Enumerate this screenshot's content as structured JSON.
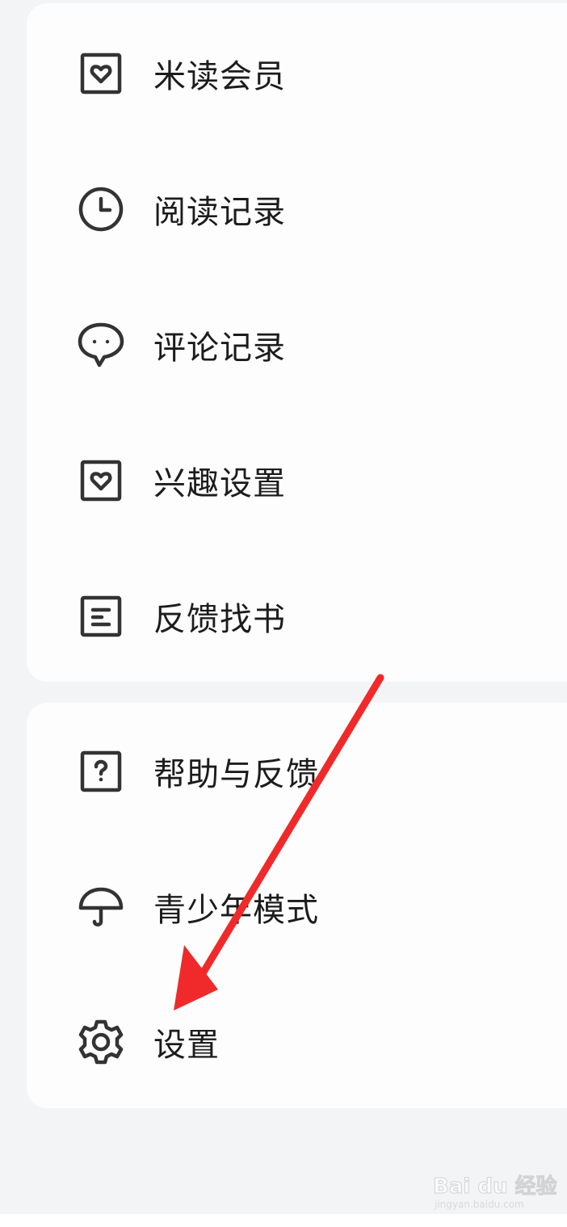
{
  "menu_group_1": [
    {
      "label": "米读会员",
      "icon": "heart-square-icon"
    },
    {
      "label": "阅读记录",
      "icon": "clock-icon"
    },
    {
      "label": "评论记录",
      "icon": "chat-bubble-icon"
    },
    {
      "label": "兴趣设置",
      "icon": "heart-square-icon"
    },
    {
      "label": "反馈找书",
      "icon": "document-icon"
    }
  ],
  "menu_group_2": [
    {
      "label": "帮助与反馈",
      "icon": "help-square-icon"
    },
    {
      "label": "青少年模式",
      "icon": "umbrella-icon"
    },
    {
      "label": "设置",
      "icon": "gear-icon"
    }
  ],
  "annotation": {
    "color": "#f02a2a",
    "target": "设置"
  },
  "watermark": {
    "main": "Bai du 经验",
    "sub": "jingyan.baidu.com"
  },
  "colors": {
    "background": "#f3f4f6",
    "card": "#fdfdfd",
    "text": "#1c1c1c",
    "icon": "#333333"
  }
}
